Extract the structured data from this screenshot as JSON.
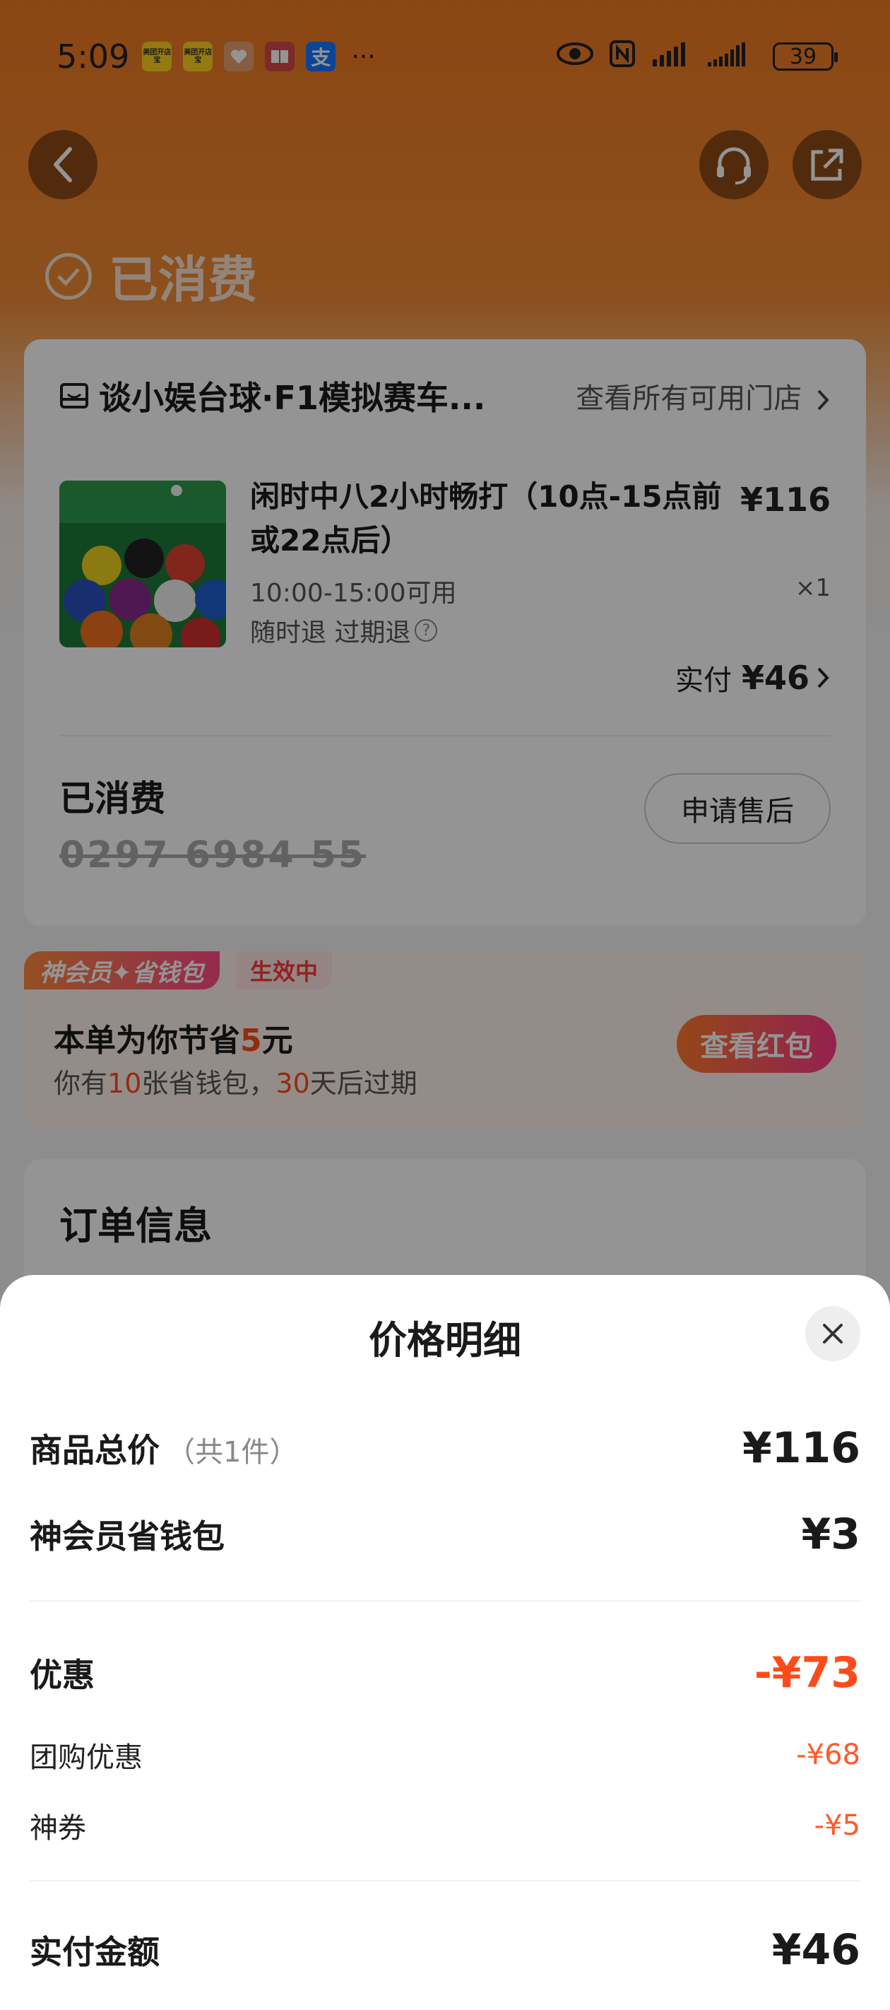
{
  "status_bar": {
    "time": "5:09",
    "apps": [
      {
        "name": "meituan-app-icon",
        "text": "美团开店宝",
        "color": "#ffd21f"
      },
      {
        "name": "meituan-app-icon-2",
        "text": "美团开店宝",
        "color": "#ffd21f"
      },
      {
        "name": "heart-app-icon",
        "text": "",
        "color": "#e8a070"
      },
      {
        "name": "book-app-icon",
        "text": "",
        "color": "#d94848"
      },
      {
        "name": "alipay-app-icon",
        "text": "支",
        "color": "#1677ff"
      }
    ],
    "more": "···",
    "battery": "39"
  },
  "header": {
    "status": "已消费"
  },
  "order_card": {
    "shop_name": "谈小娱台球·F1模拟赛车...",
    "shop_link": "查看所有可用门店",
    "product_title": "闲时中八2小时畅打（10点-15点前或22点后）",
    "product_price": "¥116",
    "time_range": "10:00-15:00可用",
    "quantity": "×1",
    "refund_policy": "随时退 过期退",
    "paid_label": "实付",
    "paid_amount": "¥46",
    "consumed_label": "已消费",
    "code": "0297 6984 55",
    "aftersale_button": "申请售后"
  },
  "member": {
    "tag": "神会员✦省钱包",
    "active": "生效中",
    "save_prefix": "本单为你节省",
    "save_amount": "5",
    "save_suffix": "元",
    "sub_prefix": "你有",
    "sub_count": "10",
    "sub_mid": "张省钱包，",
    "sub_days": "30",
    "sub_suffix": "天后过期",
    "button": "查看红包"
  },
  "order_info": {
    "title": "订单信息"
  },
  "price_sheet": {
    "title": "价格明细",
    "total_label": "商品总价",
    "total_sub": "（共1件）",
    "total_value": "¥116",
    "wallet_label": "神会员省钱包",
    "wallet_value": "¥3",
    "discount_label": "优惠",
    "discount_value": "-¥73",
    "group_label": "团购优惠",
    "group_value": "-¥68",
    "coupon_label": "神券",
    "coupon_value": "-¥5",
    "paid_label": "实付金额",
    "paid_value": "¥46"
  }
}
